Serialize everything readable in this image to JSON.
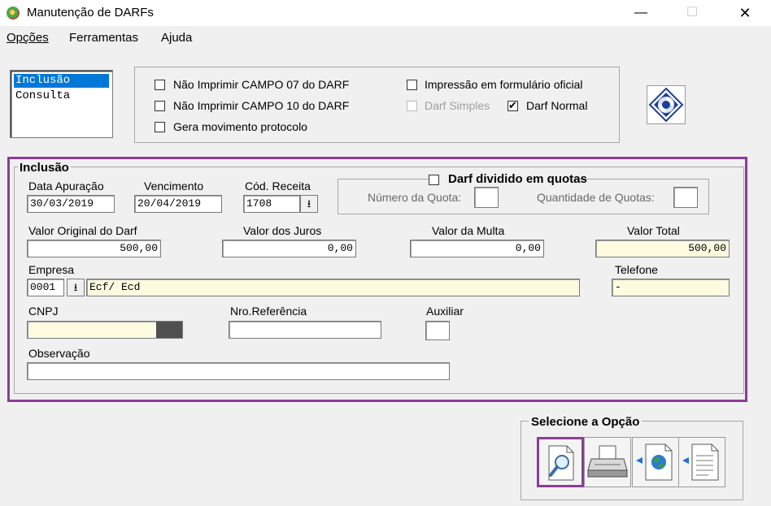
{
  "window": {
    "title": "Manutenção de DARFs",
    "minimize": "—",
    "maximize": "☐",
    "close": "✕"
  },
  "menu": [
    {
      "label": "Opções"
    },
    {
      "label": "Ferramentas"
    },
    {
      "label": "Ajuda"
    }
  ],
  "mode_list": {
    "items": [
      "Inclusão",
      "Consulta"
    ],
    "selected": "Inclusão"
  },
  "options": {
    "nao_imprimir_07": {
      "label": "Não Imprimir CAMPO 07 do DARF",
      "checked": false
    },
    "nao_imprimir_10": {
      "label": "Não Imprimir CAMPO 10 do DARF",
      "checked": false
    },
    "gera_movimento": {
      "label": "Gera movimento protocolo",
      "checked": false
    },
    "impressao_oficial": {
      "label": "Impressão em formulário oficial",
      "checked": false
    },
    "darf_simples": {
      "label": "Darf Simples",
      "checked": false,
      "disabled": true
    },
    "darf_normal": {
      "label": "Darf Normal",
      "checked": true
    }
  },
  "inclusao": {
    "title": "Inclusão",
    "data_apuracao": {
      "label": "Data  Apuração",
      "value": "30/03/2019"
    },
    "vencimento": {
      "label": "Vencimento",
      "value": "20/04/2019"
    },
    "cod_receita": {
      "label": "Cód. Receita",
      "value": "1708"
    },
    "quotas": {
      "label": "Darf dividido em quotas",
      "checked": false,
      "numero_label": "Número da Quota:",
      "numero_value": "",
      "quantidade_label": "Quantidade de Quotas:",
      "quantidade_value": ""
    },
    "valor_original": {
      "label": "Valor Original do Darf",
      "value": "500,00"
    },
    "valor_juros": {
      "label": "Valor dos Juros",
      "value": "0,00"
    },
    "valor_multa": {
      "label": "Valor da Multa",
      "value": "0,00"
    },
    "valor_total": {
      "label": "Valor Total",
      "value": "500,00"
    },
    "empresa": {
      "label": "Empresa",
      "code": "0001",
      "name": "Ecf/ Ecd"
    },
    "telefone": {
      "label": "Telefone",
      "value": "-"
    },
    "cnpj": {
      "label": "CNPJ",
      "value": ""
    },
    "nro_referencia": {
      "label": "Nro.Referência",
      "value": ""
    },
    "auxiliar": {
      "label": "Auxiliar",
      "value": ""
    },
    "observacao": {
      "label": "Observação",
      "value": ""
    }
  },
  "select_option": {
    "title": "Selecione a Opção",
    "buttons": [
      "search-document-icon",
      "printer-icon",
      "export-globe-icon",
      "export-document-icon"
    ]
  },
  "colors": {
    "highlight_border": "#8b3d98",
    "selection": "#0078d7",
    "readonly_field": "#fefbe1"
  }
}
